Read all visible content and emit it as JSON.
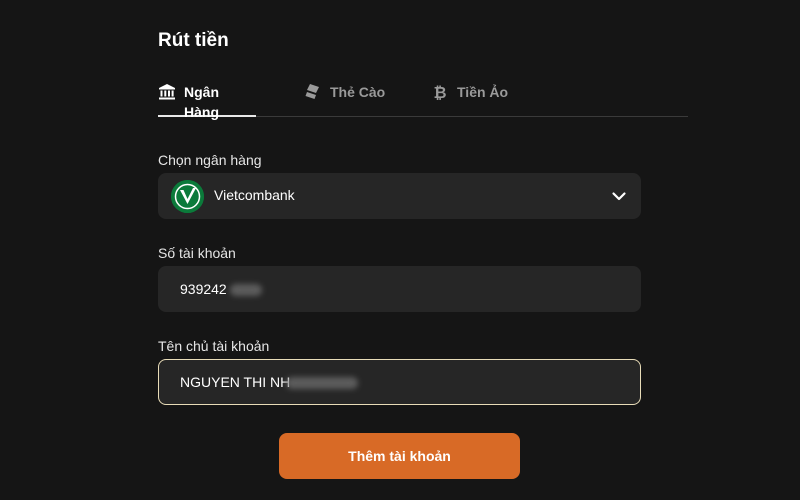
{
  "page": {
    "title": "Rút tiền"
  },
  "tabs": [
    {
      "label": "Ngân Hàng",
      "icon": "bank-icon",
      "active": true
    },
    {
      "label": "Thẻ Cào",
      "icon": "card-stack-icon",
      "active": false
    },
    {
      "label": "Tiền Ảo",
      "icon": "bitcoin-icon",
      "active": false
    }
  ],
  "bank_select": {
    "label": "Chọn ngân hàng",
    "value": "Vietcombank",
    "logo": "vietcombank-logo-icon"
  },
  "account_number": {
    "label": "Số tài khoản",
    "value": "939242"
  },
  "account_name": {
    "label": "Tên chủ tài khoản",
    "value": "NGUYEN THI NH"
  },
  "submit": {
    "label": "Thêm tài khoản"
  },
  "colors": {
    "accent": "#d86a26",
    "background": "#151515",
    "field": "#262626",
    "focus_border": "#e8dcb8"
  }
}
